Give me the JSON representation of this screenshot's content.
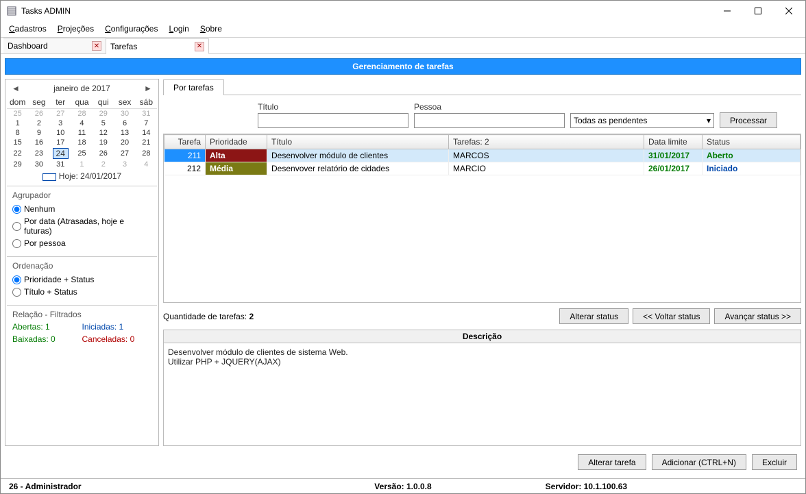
{
  "window": {
    "title": "Tasks ADMIN"
  },
  "menu": {
    "items": [
      "Cadastros",
      "Projeções",
      "Configurações",
      "Login",
      "Sobre"
    ]
  },
  "doc_tabs": [
    {
      "label": "Dashboard",
      "active": false
    },
    {
      "label": "Tarefas",
      "active": true
    }
  ],
  "banner": "Gerenciamento de tarefas",
  "calendar": {
    "title": "janeiro de 2017",
    "dow": [
      "dom",
      "seg",
      "ter",
      "qua",
      "qui",
      "sex",
      "sáb"
    ],
    "weeks": [
      [
        {
          "d": 25,
          "dim": true
        },
        {
          "d": 26,
          "dim": true
        },
        {
          "d": 27,
          "dim": true
        },
        {
          "d": 28,
          "dim": true
        },
        {
          "d": 29,
          "dim": true
        },
        {
          "d": 30,
          "dim": true
        },
        {
          "d": 31,
          "dim": true
        }
      ],
      [
        {
          "d": 1
        },
        {
          "d": 2
        },
        {
          "d": 3
        },
        {
          "d": 4
        },
        {
          "d": 5
        },
        {
          "d": 6
        },
        {
          "d": 7
        }
      ],
      [
        {
          "d": 8
        },
        {
          "d": 9
        },
        {
          "d": 10
        },
        {
          "d": 11
        },
        {
          "d": 12
        },
        {
          "d": 13
        },
        {
          "d": 14
        }
      ],
      [
        {
          "d": 15
        },
        {
          "d": 16
        },
        {
          "d": 17
        },
        {
          "d": 18
        },
        {
          "d": 19
        },
        {
          "d": 20
        },
        {
          "d": 21
        }
      ],
      [
        {
          "d": 22
        },
        {
          "d": 23
        },
        {
          "d": 24,
          "today": true
        },
        {
          "d": 25
        },
        {
          "d": 26
        },
        {
          "d": 27
        },
        {
          "d": 28
        }
      ],
      [
        {
          "d": 29
        },
        {
          "d": 30
        },
        {
          "d": 31
        },
        {
          "d": 1,
          "dim": true
        },
        {
          "d": 2,
          "dim": true
        },
        {
          "d": 3,
          "dim": true
        },
        {
          "d": 4,
          "dim": true
        }
      ]
    ],
    "today_label": "Hoje: 24/01/2017"
  },
  "agrupador": {
    "title": "Agrupador",
    "options": [
      "Nenhum",
      "Por data (Atrasadas, hoje e futuras)",
      "Por pessoa"
    ],
    "selected": 0
  },
  "ordenacao": {
    "title": "Ordenação",
    "options": [
      "Prioridade + Status",
      "Título + Status"
    ],
    "selected": 0
  },
  "relacao": {
    "title": "Relação - Filtrados",
    "abertas_label": "Abertas:",
    "abertas": "1",
    "iniciadas_label": "Iniciadas:",
    "iniciadas": "1",
    "baixadas_label": "Baixadas:",
    "baixadas": "0",
    "canceladas_label": "Canceladas:",
    "canceladas": "0"
  },
  "inner_tab": "Por tarefas",
  "filters": {
    "titulo_label": "Título",
    "pessoa_label": "Pessoa",
    "combo_value": "Todas as pendentes",
    "processar": "Processar"
  },
  "columns": [
    "Tarefa",
    "Prioridade",
    "Título",
    "Tarefas: 2",
    "Data limite",
    "Status"
  ],
  "colwidths": [
    "60px",
    "90px",
    "265px",
    "285px",
    "85px",
    "auto"
  ],
  "rows": [
    {
      "tarefa": "211",
      "prioridade": "Alta",
      "prio_class": "prio-alta",
      "titulo": "Desenvolver módulo de clientes",
      "pessoa": "MARCOS",
      "limite": "31/01/2017",
      "status": "Aberto",
      "status_class": "status-aberto",
      "selected": true
    },
    {
      "tarefa": "212",
      "prioridade": "Média",
      "prio_class": "prio-media",
      "titulo": "Desenvover relatório de cidades",
      "pessoa": "MARCIO",
      "limite": "26/01/2017",
      "status": "Iniciado",
      "status_class": "status-iniciado",
      "selected": false
    }
  ],
  "grid_footer": {
    "count_label": "Quantidade de tarefas:",
    "count_value": "2",
    "btn_alterar_status": "Alterar status",
    "btn_voltar": "<< Voltar status",
    "btn_avancar": "Avançar status >>"
  },
  "descricao": {
    "title": "Descrição",
    "body": "Desenvolver módulo de clientes de sistema Web.\nUtilizar PHP + JQUERY(AJAX)"
  },
  "bottom_buttons": {
    "alterar": "Alterar tarefa",
    "adicionar": "Adicionar (CTRL+N)",
    "excluir": "Excluir"
  },
  "statusbar": {
    "user": "26 - Administrador",
    "version": "Versão: 1.0.0.8",
    "server": "Servidor: 10.1.100.63"
  }
}
